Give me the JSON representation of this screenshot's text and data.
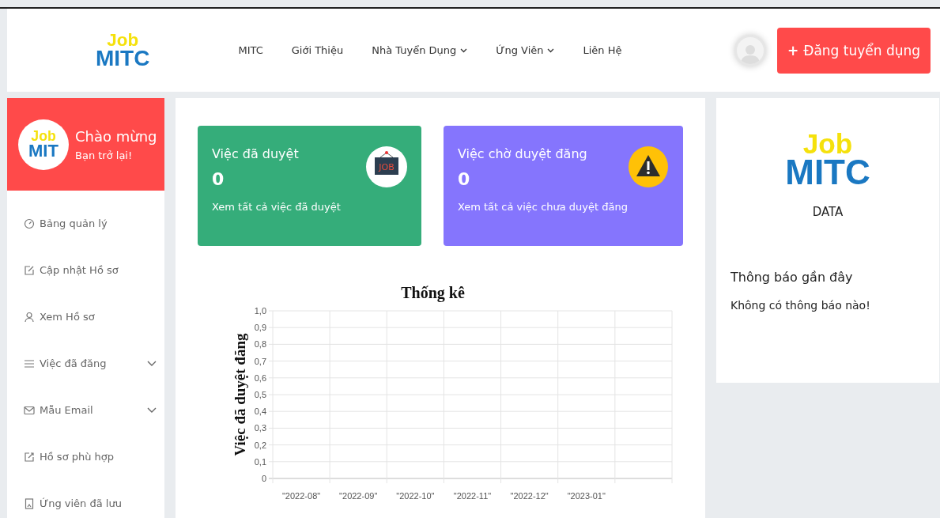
{
  "header": {
    "logo": {
      "top": "Job",
      "bottom": "MITC"
    },
    "nav": [
      {
        "label": "MITC",
        "dropdown": false
      },
      {
        "label": "Giới Thiệu",
        "dropdown": false
      },
      {
        "label": "Nhà Tuyển Dụng",
        "dropdown": true
      },
      {
        "label": "Ứng Viên",
        "dropdown": true
      },
      {
        "label": "Liên Hệ",
        "dropdown": false
      }
    ],
    "post_button": {
      "icon": "+",
      "label": "Đăng tuyển dụng"
    }
  },
  "sidebar": {
    "welcome": {
      "logo": {
        "top": "Job",
        "bottom": "MIT"
      },
      "title": "Chào mừng",
      "subtitle": "Bạn trở lại!"
    },
    "items": [
      {
        "label": "Bảng quản lý",
        "kind": "gauge",
        "expandable": false
      },
      {
        "label": "Cập nhật Hồ sơ",
        "kind": "edit",
        "expandable": false
      },
      {
        "label": "Xem Hồ sơ",
        "kind": "user",
        "expandable": false
      },
      {
        "label": "Việc đã đăng",
        "kind": "list",
        "expandable": true
      },
      {
        "label": "Mẫu Email",
        "kind": "mail",
        "expandable": true
      },
      {
        "label": "Hồ sơ phù hợp",
        "kind": "external",
        "expandable": false
      },
      {
        "label": "Ứng viên đã lưu",
        "kind": "bookmark",
        "expandable": false
      }
    ]
  },
  "stats": [
    {
      "title": "Việc đã duyệt",
      "count": "0",
      "link": "Xem tất cả việc đã duyệt",
      "color": "#35ad7a",
      "kind": "job",
      "icon_text": "JOB"
    },
    {
      "title": "Việc chờ duyệt đăng",
      "count": "0",
      "link": "Xem tất cả việc chưa duyệt đăng",
      "color": "#8575fd",
      "kind": "warning"
    }
  ],
  "chart_data": {
    "type": "bar",
    "title": "Thống kê",
    "grid": true,
    "ylabel": "Việc đã duyệt đăng",
    "categories": [
      "\"2022-08\"",
      "\"2022-09\"",
      "\"2022-10\"",
      "\"2022-11\"",
      "\"2022-12\"",
      "\"2023-01\""
    ],
    "values": [
      null,
      null,
      null,
      null,
      null,
      null
    ],
    "ylim": [
      0,
      1
    ],
    "yticks": [
      {
        "value": 0,
        "label": "0"
      },
      {
        "value": 0.1,
        "label": "0,1"
      },
      {
        "value": 0.2,
        "label": "0,2"
      },
      {
        "value": 0.3,
        "label": "0,3"
      },
      {
        "value": 0.4,
        "label": "0,4"
      },
      {
        "value": 0.5,
        "label": "0,5"
      },
      {
        "value": 0.6,
        "label": "0,6"
      },
      {
        "value": 0.7,
        "label": "0,7"
      },
      {
        "value": 0.8,
        "label": "0,8"
      },
      {
        "value": 0.9,
        "label": "0,9"
      },
      {
        "value": 1,
        "label": "1,0"
      }
    ]
  },
  "right_panel": {
    "logo": {
      "top": "Job",
      "bottom": "MITC"
    },
    "caption": "DATA",
    "notifications_title": "Thông báo gần đây",
    "notifications_empty": "Không có thông báo nào!"
  }
}
